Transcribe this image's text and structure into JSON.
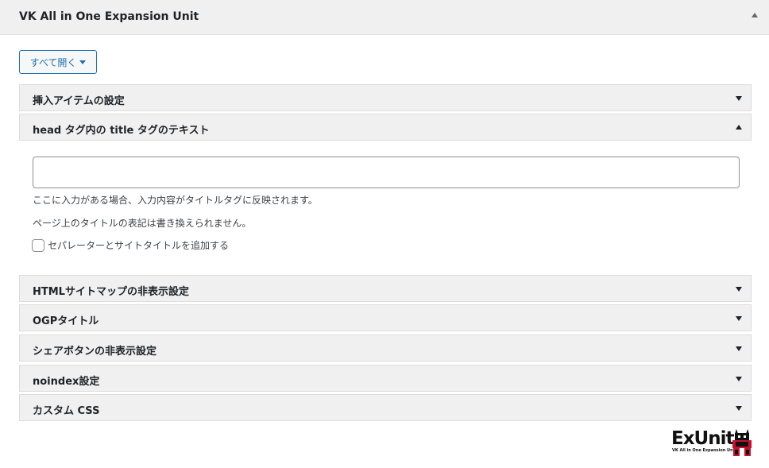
{
  "metabox": {
    "title": "VK All in One Expansion Unit"
  },
  "controls": {
    "expand_all_label": "すべて開く"
  },
  "sections": [
    {
      "label": "挿入アイテムの設定",
      "expanded": false
    },
    {
      "label": "head タグ内の title タグのテキスト",
      "expanded": true
    },
    {
      "label": "HTMLサイトマップの非表示設定",
      "expanded": false
    },
    {
      "label": "OGPタイトル",
      "expanded": false
    },
    {
      "label": "シェアボタンの非表示設定",
      "expanded": false
    },
    {
      "label": "noindex設定",
      "expanded": false
    },
    {
      "label": "カスタム CSS",
      "expanded": false
    }
  ],
  "title_panel": {
    "input_value": "",
    "help_line1": "ここに入力がある場合、入力内容がタイトルタグに反映されます。",
    "help_line2": "ページ上のタイトルの表記は書き換えられません。",
    "checkbox_label": "セパレーターとサイトタイトルを追加する",
    "checkbox_checked": false
  },
  "logo": {
    "text": "ExUnit",
    "subtext": "VK All in One Expansion Unit",
    "icon": "robot-icon",
    "accent_color": "#c8102e"
  }
}
